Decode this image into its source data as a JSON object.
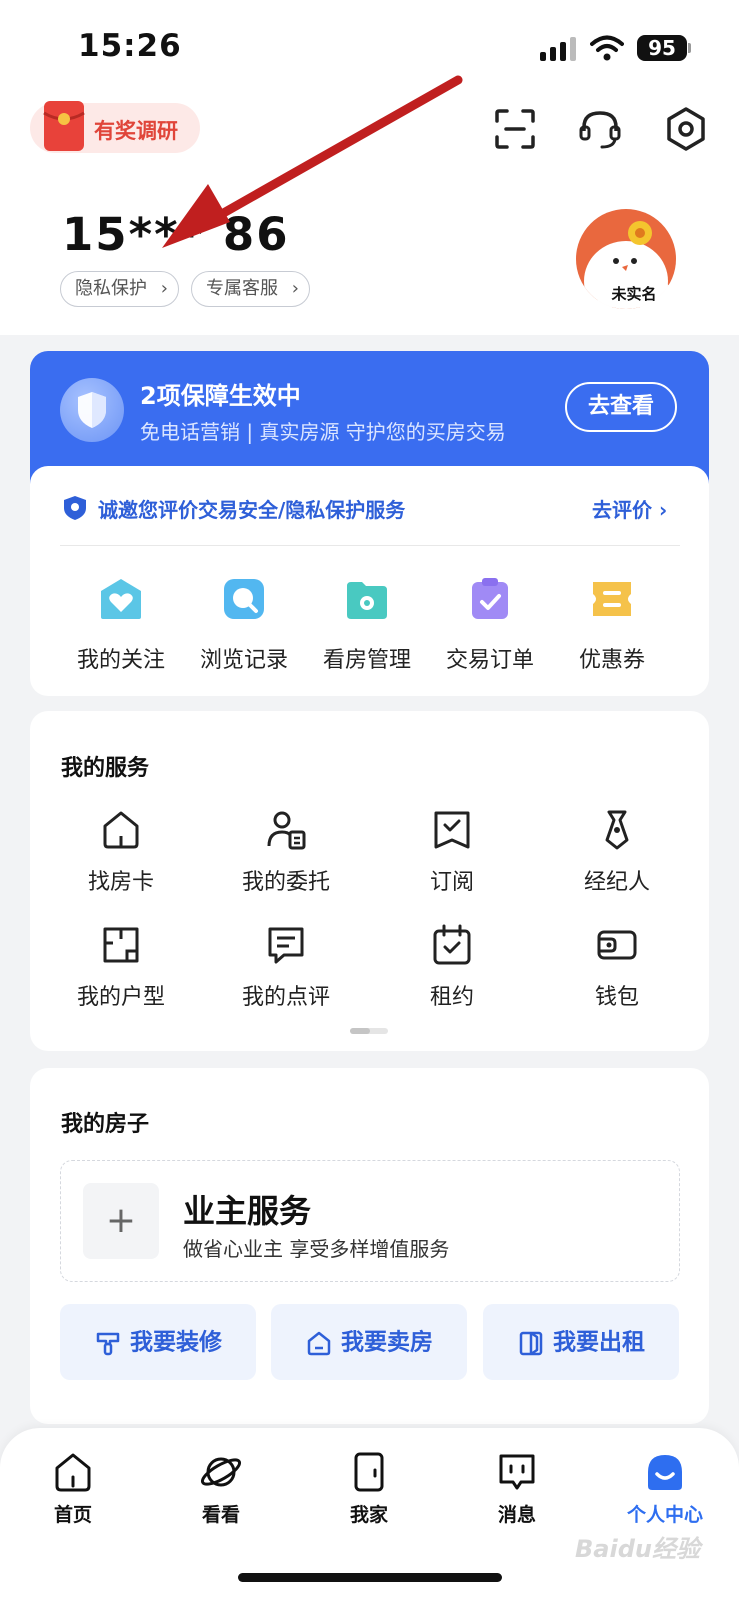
{
  "status_bar": {
    "time": "15:26",
    "battery": "95"
  },
  "header": {
    "survey_label": "有奖调研"
  },
  "profile": {
    "phone": "15*** 86",
    "privacy_chip": "隐私保护",
    "service_chip": "专属客服",
    "avatar_tag": "未实名"
  },
  "banner": {
    "title": "2项保障生效中",
    "subtitle": "免电话营销 | 真实房源  守护您的买房交易",
    "button": "去查看"
  },
  "rating": {
    "text": "诚邀您评价交易安全/隐私保护服务",
    "link": "去评价"
  },
  "quick_items": [
    {
      "label": "我的关注",
      "icon": "heart-icon",
      "color": "#5bc6e6"
    },
    {
      "label": "浏览记录",
      "icon": "search-icon",
      "color": "#52b7f0"
    },
    {
      "label": "看房管理",
      "icon": "folder-icon",
      "color": "#49c9c1"
    },
    {
      "label": "交易订单",
      "icon": "order-icon",
      "color": "#a08af5"
    },
    {
      "label": "优惠券",
      "icon": "coupon-icon",
      "color": "#f5c24a"
    }
  ],
  "services": {
    "title": "我的服务",
    "items": [
      {
        "label": "找房卡",
        "icon": "house-card-icon"
      },
      {
        "label": "我的委托",
        "icon": "entrust-icon"
      },
      {
        "label": "订阅",
        "icon": "subscribe-icon"
      },
      {
        "label": "经纪人",
        "icon": "agent-icon"
      },
      {
        "label": "我的户型",
        "icon": "floorplan-icon"
      },
      {
        "label": "我的点评",
        "icon": "review-icon"
      },
      {
        "label": "租约",
        "icon": "lease-icon"
      },
      {
        "label": "钱包",
        "icon": "wallet-icon"
      }
    ]
  },
  "my_house": {
    "title": "我的房子",
    "owner_title": "业主服务",
    "owner_sub": "做省心业主 享受多样增值服务",
    "actions": [
      {
        "label": "我要装修",
        "icon": "decorate-icon"
      },
      {
        "label": "我要卖房",
        "icon": "sell-house-icon"
      },
      {
        "label": "我要出租",
        "icon": "rent-out-icon"
      }
    ]
  },
  "tabbar": {
    "items": [
      {
        "label": "首页",
        "icon": "home-icon"
      },
      {
        "label": "看看",
        "icon": "planet-icon"
      },
      {
        "label": "我家",
        "icon": "door-icon"
      },
      {
        "label": "消息",
        "icon": "message-icon"
      },
      {
        "label": "个人中心",
        "icon": "profile-icon",
        "active": true
      }
    ]
  },
  "watermark": "Baidu经验",
  "colors": {
    "brand_blue": "#3a6df0",
    "link_blue": "#2e5fd8",
    "survey_red": "#e0453a"
  }
}
